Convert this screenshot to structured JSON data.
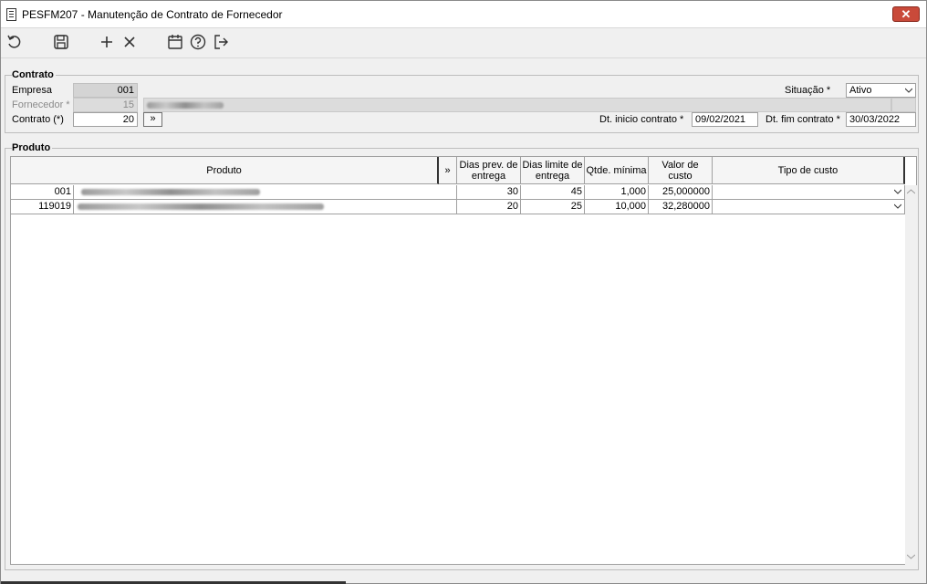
{
  "window": {
    "title": "PESFM207 - Manutenção de Contrato de Fornecedor",
    "close_label": "✕"
  },
  "toolbar": {
    "icons": [
      "refresh-icon",
      "save-icon",
      "add-icon",
      "delete-icon",
      "calendar-icon",
      "help-icon",
      "exit-icon"
    ]
  },
  "contrato": {
    "legend": "Contrato",
    "empresa_label": "Empresa",
    "empresa_value": "001",
    "fornecedor_label": "Fornecedor *",
    "fornecedor_value": "15",
    "contrato_label": "Contrato (*)",
    "contrato_value": "20",
    "more_button": "»",
    "situacao_label": "Situação *",
    "situacao_value": "Ativo",
    "dt_inicio_label": "Dt. inicio contrato *",
    "dt_inicio_value": "09/02/2021",
    "dt_fim_label": "Dt. fim contrato *",
    "dt_fim_value": "30/03/2022"
  },
  "produto": {
    "legend": "Produto",
    "headers": {
      "produto": "Produto",
      "more": "»",
      "dias_prev": "Dias prev. de entrega",
      "dias_limite": "Dias limite de entrega",
      "qtde": "Qtde. mínima",
      "valor": "Valor de custo",
      "tipo": "Tipo de custo"
    },
    "rows": [
      {
        "codigo": "001",
        "dias_prev": "30",
        "dias_limite": "45",
        "qtde": "1,000",
        "valor": "25,000000",
        "tipo": ""
      },
      {
        "codigo": "119019",
        "dias_prev": "20",
        "dias_limite": "25",
        "qtde": "10,000",
        "valor": "32,280000",
        "tipo": ""
      }
    ]
  }
}
